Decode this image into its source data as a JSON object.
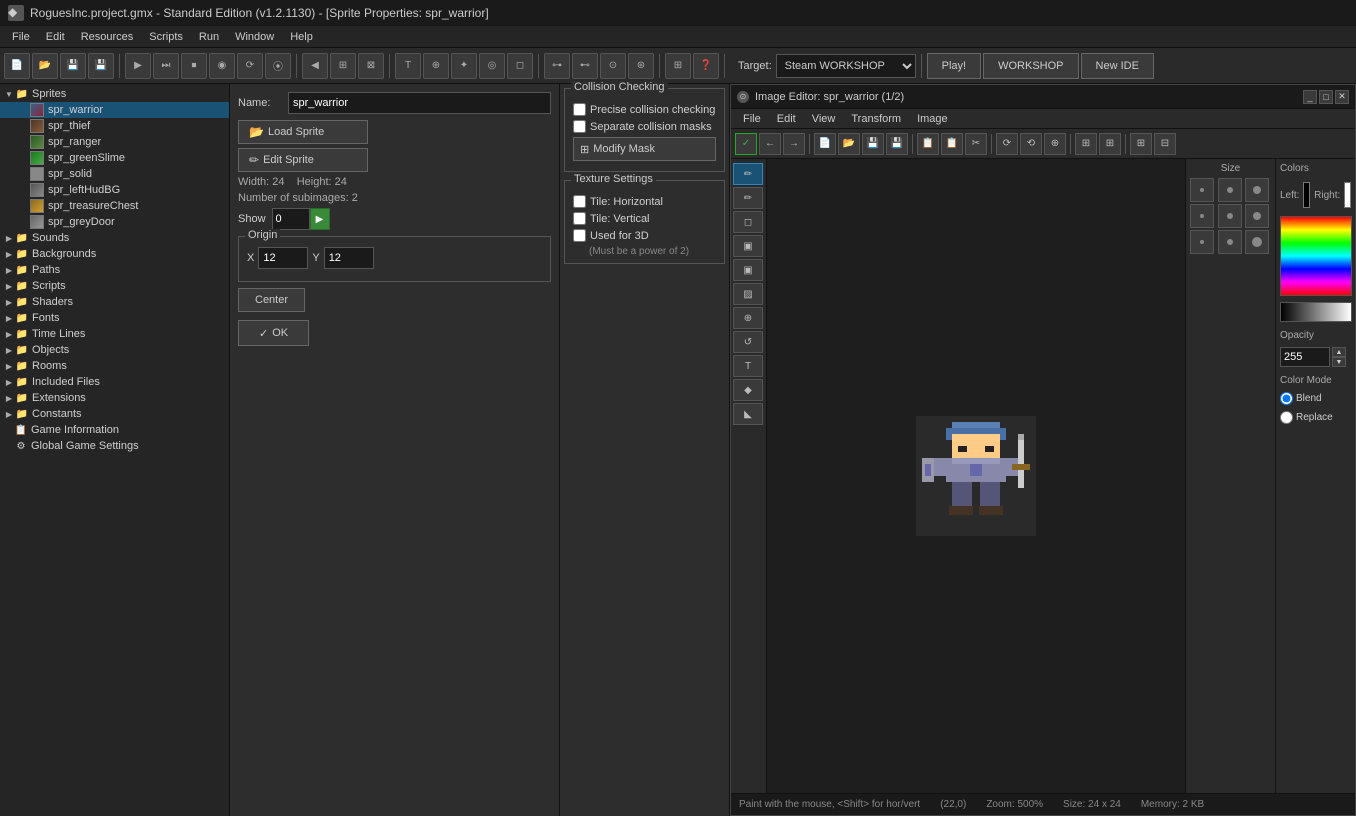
{
  "titlebar": {
    "title": "RoguesInc.project.gmx  -  Standard Edition (v1.2.1130) - [Sprite Properties: spr_warrior]",
    "icon": "◆"
  },
  "menubar": {
    "items": [
      "File",
      "Edit",
      "Resources",
      "Scripts",
      "Run",
      "Window",
      "Help"
    ]
  },
  "toolbar": {
    "target_label": "Target:",
    "target_value": "Steam WORKSHOP",
    "play_label": "Play!",
    "workshop_label": "WORKSHOP",
    "new_ide_label": "New IDE"
  },
  "sidebar": {
    "sprites_label": "Sprites",
    "sounds_label": "Sounds",
    "backgrounds_label": "Backgrounds",
    "paths_label": "Paths",
    "scripts_label": "Scripts",
    "shaders_label": "Shaders",
    "fonts_label": "Fonts",
    "timelines_label": "Time Lines",
    "objects_label": "Objects",
    "rooms_label": "Rooms",
    "included_files_label": "Included Files",
    "extensions_label": "Extensions",
    "constants_label": "Constants",
    "game_info_label": "Game Information",
    "global_settings_label": "Global Game Settings",
    "sprites": [
      {
        "name": "spr_warrior",
        "selected": true
      },
      {
        "name": "spr_thief"
      },
      {
        "name": "spr_ranger"
      },
      {
        "name": "spr_greenSlime"
      },
      {
        "name": "spr_solid"
      },
      {
        "name": "spr_leftHudBG"
      },
      {
        "name": "spr_treasureChest"
      },
      {
        "name": "spr_greyDoor"
      }
    ]
  },
  "properties": {
    "name_label": "Name:",
    "name_value": "spr_warrior",
    "load_sprite_label": "Load Sprite",
    "edit_sprite_label": "Edit Sprite",
    "width_label": "Width:",
    "width_value": "24",
    "height_label": "Height:",
    "height_value": "24",
    "subimages_label": "Number of subimages:",
    "subimages_value": "2",
    "show_label": "Show",
    "show_value": "0",
    "origin_label": "Origin",
    "x_label": "X",
    "x_value": "12",
    "y_label": "Y",
    "y_value": "12",
    "center_label": "Center",
    "ok_label": "OK"
  },
  "collision": {
    "title": "Collision Checking",
    "precise_label": "Precise collision checking",
    "separate_label": "Separate collision masks",
    "modify_label": "Modify Mask"
  },
  "texture": {
    "title": "Texture Settings",
    "tile_h_label": "Tile: Horizontal",
    "tile_v_label": "Tile: Vertical",
    "used_3d_label": "Used for 3D",
    "power_of_2_label": "(Must be a power of 2)"
  },
  "image_editor": {
    "title": "Image Editor: spr_warrior (1/2)",
    "menu": [
      "File",
      "Edit",
      "View",
      "Transform",
      "Image"
    ],
    "tools": [
      "✏",
      "✏",
      "◻",
      "▣",
      "▣",
      "▨",
      "⊕",
      "↺",
      "T",
      "◆",
      "◣"
    ],
    "status_text": "Paint with the mouse, <Shift> for hor/vert",
    "coords": "(22,0)",
    "zoom": "Zoom: 500%",
    "size": "Size: 24 x 24",
    "memory": "Memory: 2 KB"
  },
  "colors_panel": {
    "title": "Colors",
    "left_label": "Left:",
    "right_label": "Right:",
    "left_color": "#000000",
    "right_color": "#ffffff",
    "opacity_label": "Opacity",
    "opacity_value": "255",
    "color_mode_label": "Color Mode",
    "blend_label": "Blend",
    "replace_label": "Replace"
  }
}
